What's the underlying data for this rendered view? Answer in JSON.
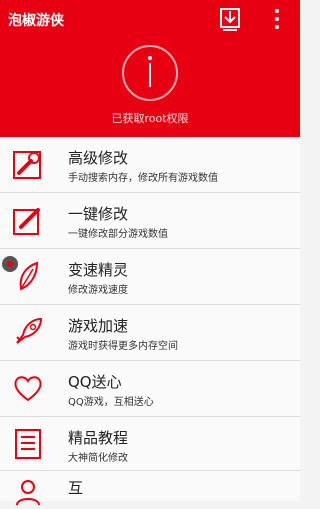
{
  "header": {
    "title": "泡椒游侠",
    "status": "已获取root权限",
    "download_icon": "download-icon",
    "more_icon": "more-vertical-icon",
    "brand_color": "#e60012"
  },
  "menu": [
    {
      "label": "高级修改",
      "desc": "手动搜索内存，修改所有游戏数值",
      "icon": "wrench-icon"
    },
    {
      "label": "一键修改",
      "desc": "一键修改部分游戏数值",
      "icon": "edit-pencil-icon"
    },
    {
      "label": "变速精灵",
      "desc": "修改游戏速度",
      "icon": "leaf-icon"
    },
    {
      "label": "游戏加速",
      "desc": "游戏时获得更多内存空间",
      "icon": "rocket-icon"
    },
    {
      "label": "QQ送心",
      "desc": "QQ游戏，互相送心",
      "icon": "heart-icon"
    },
    {
      "label": "精品教程",
      "desc": "大神简化修改",
      "icon": "list-icon"
    }
  ],
  "bottom": {
    "label": "互",
    "icon": "people-icon"
  }
}
